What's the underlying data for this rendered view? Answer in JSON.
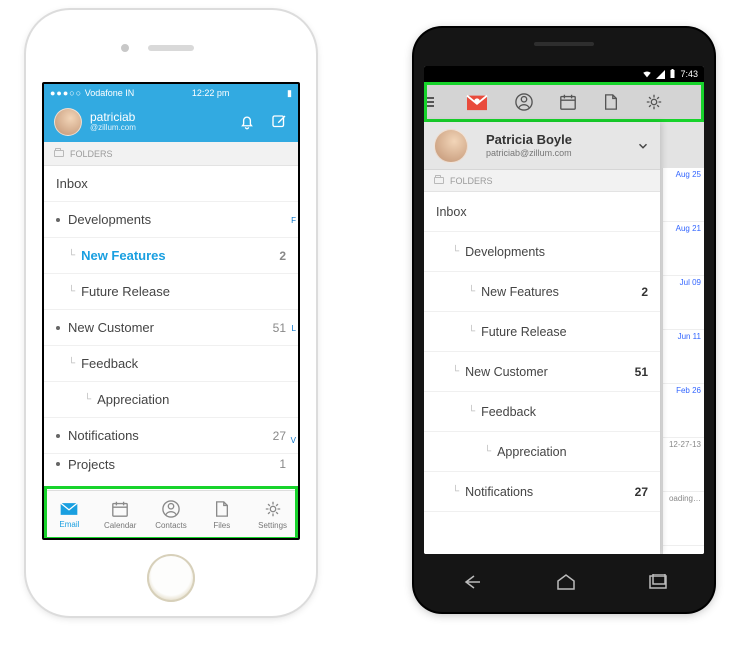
{
  "ios": {
    "status": {
      "carrier": "Vodafone IN",
      "time": "12:22 pm",
      "dots": "●●●○○"
    },
    "user": {
      "name": "patriciab",
      "domain": "@zillum.com"
    },
    "folders_header": "FOLDERS",
    "folders": [
      {
        "label": "Inbox",
        "level": 0,
        "count": "",
        "bullet": false,
        "sel": false
      },
      {
        "label": "Developments",
        "level": 0,
        "count": "",
        "bullet": true,
        "sel": false
      },
      {
        "label": "New Features",
        "level": 1,
        "count": "2",
        "bullet": false,
        "sel": true
      },
      {
        "label": "Future Release",
        "level": 1,
        "count": "",
        "bullet": false,
        "sel": false
      },
      {
        "label": "New Customer",
        "level": 0,
        "count": "51",
        "bullet": true,
        "sel": false
      },
      {
        "label": "Feedback",
        "level": 1,
        "count": "",
        "bullet": false,
        "sel": false
      },
      {
        "label": "Appreciation",
        "level": 2,
        "count": "",
        "bullet": false,
        "sel": false
      },
      {
        "label": "Notifications",
        "level": 0,
        "count": "27",
        "bullet": true,
        "sel": false
      },
      {
        "label": "Projects",
        "level": 0,
        "count": "1",
        "bullet": true,
        "sel": false
      }
    ],
    "side_letters": [
      "F",
      "L",
      "V"
    ],
    "tabs": [
      {
        "label": "Email",
        "icon": "mail",
        "active": true
      },
      {
        "label": "Calendar",
        "icon": "calendar",
        "active": false
      },
      {
        "label": "Contacts",
        "icon": "contacts",
        "active": false
      },
      {
        "label": "Files",
        "icon": "files",
        "active": false
      },
      {
        "label": "Settings",
        "icon": "settings",
        "active": false
      }
    ]
  },
  "android": {
    "status": {
      "time": "7:43"
    },
    "toolbar_icons": [
      "mail",
      "contacts",
      "calendar",
      "files",
      "settings"
    ],
    "user": {
      "name": "Patricia Boyle",
      "email": "patriciab@zillum.com"
    },
    "folders_header": "FOLDERS",
    "folders": [
      {
        "label": "Inbox",
        "level": 0,
        "count": ""
      },
      {
        "label": "Developments",
        "level": 1,
        "count": ""
      },
      {
        "label": "New Features",
        "level": 2,
        "count": "2"
      },
      {
        "label": "Future Release",
        "level": 2,
        "count": ""
      },
      {
        "label": "New Customer",
        "level": 1,
        "count": "51"
      },
      {
        "label": "Feedback",
        "level": 2,
        "count": ""
      },
      {
        "label": "Appreciation",
        "level": 3,
        "count": ""
      },
      {
        "label": "Notifications",
        "level": 1,
        "count": "27"
      }
    ],
    "mail_dates": [
      "Aug 25",
      "Aug 21",
      "Jul 09",
      "Jun 11",
      "Feb 26",
      "12-27-13",
      "oading…"
    ]
  }
}
